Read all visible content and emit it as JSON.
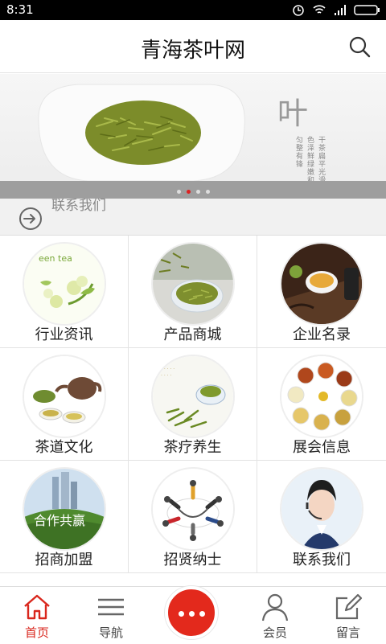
{
  "status_bar": {
    "time": "8:31"
  },
  "header": {
    "title": "青海茶叶网",
    "search_icon": "search-icon"
  },
  "banner": {
    "calligraphy": "叶",
    "vertical_text": [
      "干茶扁平光滑",
      "色泽鲜绿嫩和",
      "匀整有锋"
    ],
    "slides": 4,
    "active_slide": 1
  },
  "notice": {
    "text": "联系我们"
  },
  "grid": {
    "items": [
      {
        "label": "行业资讯",
        "icon": "industry-news-icon",
        "thumb_text": "een tea"
      },
      {
        "label": "产品商城",
        "icon": "product-mall-icon"
      },
      {
        "label": "企业名录",
        "icon": "enterprise-directory-icon"
      },
      {
        "label": "茶道文化",
        "icon": "tea-culture-icon"
      },
      {
        "label": "茶疗养生",
        "icon": "tea-health-icon"
      },
      {
        "label": "展会信息",
        "icon": "exhibition-info-icon"
      },
      {
        "label": "招商加盟",
        "icon": "franchise-icon",
        "thumb_text": "合作共赢"
      },
      {
        "label": "招贤纳士",
        "icon": "recruitment-icon"
      },
      {
        "label": "联系我们",
        "icon": "contact-us-icon"
      }
    ]
  },
  "bottom_nav": {
    "home": "首页",
    "nav": "导航",
    "member": "会员",
    "message": "留言",
    "accent": "#d9261c"
  }
}
